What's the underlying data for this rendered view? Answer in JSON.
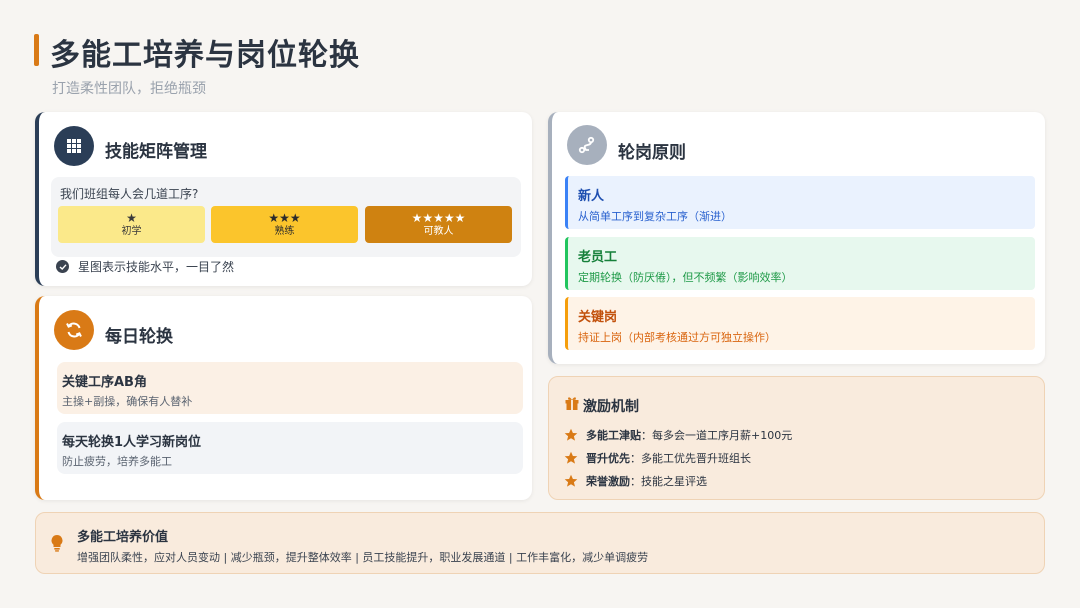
{
  "header": {
    "title": "多能工培养与岗位轮换",
    "subtitle": "打造柔性团队，拒绝瓶颈"
  },
  "skill_matrix": {
    "title": "技能矩阵管理",
    "icon": "grid-icon",
    "question": "我们班组每人会几道工序?",
    "levels": [
      {
        "stars": "★",
        "label": "初学",
        "color": "#fbe98a"
      },
      {
        "stars": "★★★",
        "label": "熟练",
        "color": "#fbc52c"
      },
      {
        "stars": "★★★★★",
        "label": "可教人",
        "color": "#cf8211"
      }
    ],
    "note": "星图表示技能水平，一目了然"
  },
  "daily_rotation": {
    "title": "每日轮换",
    "icon": "refresh-icon",
    "items": [
      {
        "title": "关键工序AB角",
        "desc": "主操+副操，确保有人替补"
      },
      {
        "title": "每天轮换1人学习新岗位",
        "desc": "防止疲劳，培养多能工"
      }
    ]
  },
  "principles": {
    "title": "轮岗原则",
    "icon": "route-icon",
    "items": [
      {
        "title": "新人",
        "desc": "从简单工序到复杂工序（渐进）",
        "color": "#3b82f6"
      },
      {
        "title": "老员工",
        "desc": "定期轮换（防厌倦），但不频繁（影响效率）",
        "color": "#22c55e"
      },
      {
        "title": "关键岗",
        "desc": "持证上岗（内部考核通过方可独立操作）",
        "color": "#f59e0b"
      }
    ]
  },
  "incentive": {
    "title": "激励机制",
    "icon": "gift-icon",
    "items": [
      {
        "label": "多能工津贴",
        "text": "：每多会一道工序月薪+100元"
      },
      {
        "label": "晋升优先",
        "text": "：多能工优先晋升班组长"
      },
      {
        "label": "荣誉激励",
        "text": "：技能之星评选"
      }
    ]
  },
  "value": {
    "title": "多能工培养价值",
    "icon": "lightbulb-icon",
    "desc": "增强团队柔性，应对人员变动 | 减少瓶颈，提升整体效率 | 员工技能提升，职业发展通道 | 工作丰富化，减少单调疲劳"
  },
  "colors": {
    "accent": "#d97a16",
    "navy": "#2b3e57"
  }
}
